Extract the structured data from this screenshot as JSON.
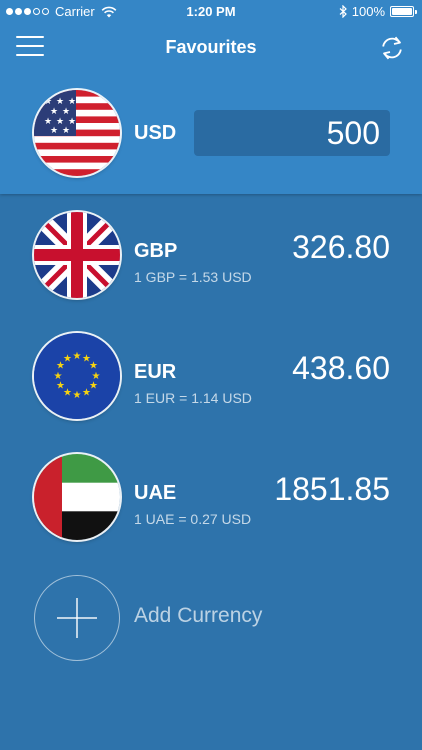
{
  "status_bar": {
    "carrier": "Carrier",
    "time": "1:20 PM",
    "battery": "100%",
    "signal_bars_filled": 3,
    "signal_bars_total": 5
  },
  "nav": {
    "title": "Favourites",
    "menu_icon": "hamburger-menu-icon",
    "refresh_icon": "refresh-icon"
  },
  "base": {
    "code": "USD",
    "amount": "500",
    "flag": "us-flag-icon"
  },
  "favourites": [
    {
      "code": "GBP",
      "rate": "1 GBP = 1.53 USD",
      "amount": "326.80",
      "flag": "uk-flag-icon"
    },
    {
      "code": "EUR",
      "rate": "1 EUR = 1.14 USD",
      "amount": "438.60",
      "flag": "eu-flag-icon"
    },
    {
      "code": "UAE",
      "rate": "1 UAE = 0.27 USD",
      "amount": "1851.85",
      "flag": "uae-flag-icon"
    }
  ],
  "add_currency": {
    "label": "Add Currency"
  },
  "colors": {
    "header": "#3586c6",
    "background": "#2e73ab",
    "input": "#2a6ba2",
    "text": "#ffffff"
  }
}
